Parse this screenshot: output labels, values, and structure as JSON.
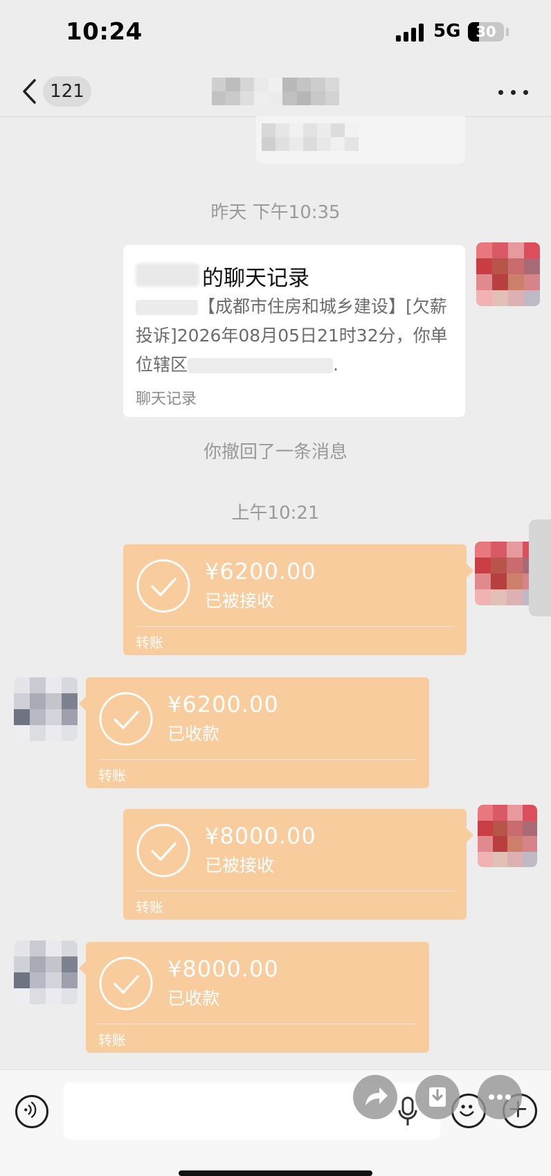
{
  "status_bar": {
    "time": "10:24",
    "network": "5G",
    "battery": "30",
    "battery_level": 0.3
  },
  "nav": {
    "unread_count": "121"
  },
  "messages": {
    "timestamp_yesterday": "昨天 下午10:35",
    "record_card": {
      "title_suffix": "的聊天记录",
      "body_part1": "【成都市住房和城乡建设】[欠薪投诉]2026年08月05日21时32分，你单位辖区",
      "body_part2": ".",
      "footer": "聊天记录"
    },
    "recall_notice": "你撤回了一条消息",
    "timestamp_morning": "上午10:21",
    "transfers": [
      {
        "amount": "¥6200.00",
        "status": "已被接收",
        "label": "转账"
      },
      {
        "amount": "¥6200.00",
        "status": "已收款",
        "label": "转账"
      },
      {
        "amount": "¥8000.00",
        "status": "已被接收",
        "label": "转账"
      },
      {
        "amount": "¥8000.00",
        "status": "已收款",
        "label": "转账"
      }
    ]
  },
  "input_bar": {
    "placeholder": ""
  },
  "colors": {
    "transfer_orange": "#f9cc9d",
    "background": "#ededed"
  }
}
